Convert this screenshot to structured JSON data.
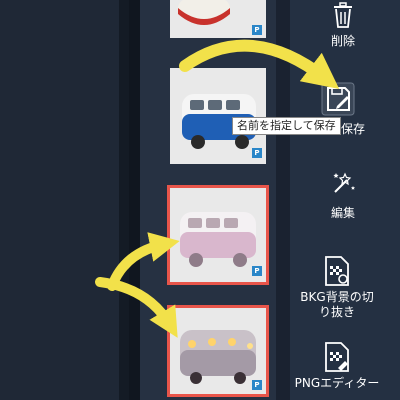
{
  "toolbar": {
    "delete_label": "削除",
    "save_label": "保存",
    "save_tooltip": "名前を指定して保存",
    "edit_label": "編集",
    "bkg_label_line1": "BKG背景の切",
    "bkg_label_line2": "り抜き",
    "png_editor_label": "PNGエディター"
  },
  "gallery": {
    "badge_text": "P",
    "items": [
      {
        "id": "tin-can",
        "selected": false
      },
      {
        "id": "blue-van",
        "selected": false
      },
      {
        "id": "pink-van",
        "selected": true
      },
      {
        "id": "lit-van",
        "selected": true
      }
    ]
  },
  "colors": {
    "selection_border": "#e8554a",
    "annotation_arrow": "#f2e14a",
    "background": "#1e2735"
  }
}
